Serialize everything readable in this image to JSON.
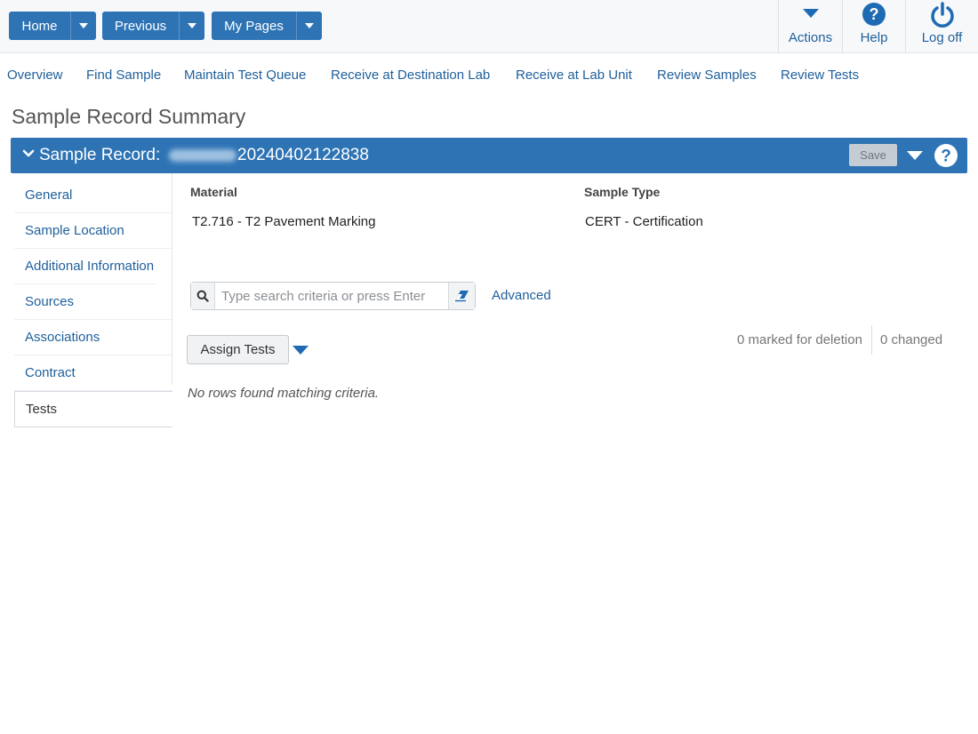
{
  "topbar": {
    "home_label": "Home",
    "previous_label": "Previous",
    "mypages_label": "My Pages",
    "actions_label": "Actions",
    "help_label": "Help",
    "logoff_label": "Log off"
  },
  "nav": {
    "items": [
      "Overview",
      "Find Sample",
      "Maintain Test Queue",
      "Receive at Destination Lab",
      "Receive at Lab Unit",
      "Review Samples",
      "Review Tests"
    ]
  },
  "page": {
    "title": "Sample Record Summary"
  },
  "record": {
    "title_prefix": "Sample Record:",
    "number": "20240402122838",
    "save_label": "Save"
  },
  "sidenav": {
    "items": [
      "General",
      "Sample Location",
      "Additional Information",
      "Sources",
      "Associations",
      "Contract",
      "Tests"
    ],
    "active": "Tests"
  },
  "fields": {
    "material_label": "Material",
    "material_value": "T2.716 - T2 Pavement Marking",
    "sample_type_label": "Sample Type",
    "sample_type_value": "CERT - Certification"
  },
  "search": {
    "placeholder": "Type search criteria or press Enter",
    "value": "",
    "advanced_label": "Advanced"
  },
  "tests": {
    "assign_label": "Assign Tests",
    "marked_for_deletion": "0 marked for deletion",
    "changed": "0 changed",
    "empty_message": "No rows found matching criteria."
  },
  "colors": {
    "primary": "#2e74b5",
    "link": "#1f5f9b",
    "disabled_button": "#c6ccd3"
  }
}
